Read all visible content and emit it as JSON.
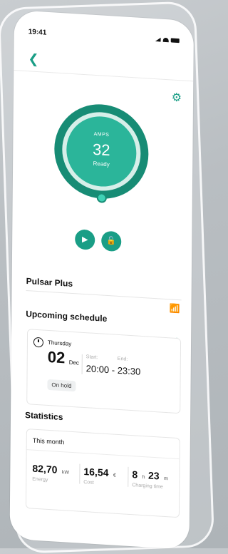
{
  "status_bar": {
    "time": "19:41"
  },
  "charger": {
    "label": "AMPS",
    "value": "32",
    "status": "Ready"
  },
  "device": {
    "name": "Pulsar Plus"
  },
  "schedule": {
    "title": "Upcoming schedule",
    "day": "Thursday",
    "date": "02",
    "month": "Dec",
    "start_label": "Start:",
    "end_label": "End:",
    "time_range": "20:00 - 23:30",
    "badge": "On hold"
  },
  "statistics": {
    "title": "Statistics",
    "period": "This month",
    "energy": {
      "value": "82,70",
      "unit": "kW",
      "label": "Energy"
    },
    "cost": {
      "value": "16,54",
      "unit": "€",
      "label": "Cost"
    },
    "charging_time": {
      "hours": "8",
      "h_unit": "h",
      "minutes": "23",
      "m_unit": "m",
      "label": "Charging time"
    }
  },
  "colors": {
    "accent": "#1a9e86",
    "dial_dark": "#178c75",
    "dial_inner": "#2bb59a"
  },
  "icons": [
    "back-arrow-icon",
    "gear-icon",
    "play-icon",
    "lock-icon",
    "wifi-icon",
    "clock-icon",
    "arrow-right-icon"
  ]
}
